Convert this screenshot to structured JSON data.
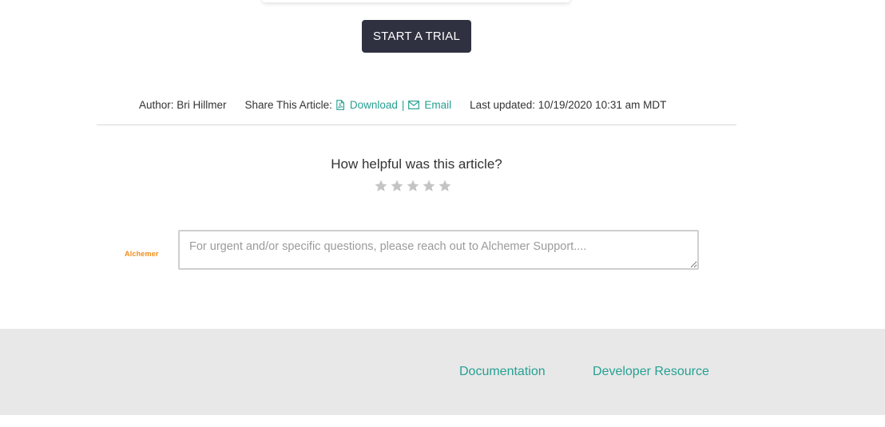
{
  "cta": {
    "label": "START A TRIAL"
  },
  "meta": {
    "author": "Author: Bri Hillmer",
    "share_label": "Share This Article:",
    "download_label": "Download",
    "separator": "|",
    "email_label": "Email",
    "last_updated": "Last updated: 10/19/2020 10:31 am MDT",
    "link_color": "#27a093"
  },
  "rating": {
    "question": "How helpful was this article?",
    "stars_total": 5,
    "stars_selected": 0,
    "star_color": "#c4c4c4"
  },
  "support": {
    "logo_text": "Alchemer",
    "placeholder": "For urgent and/or specific questions, please reach out to Alchemer Support...."
  },
  "footer": {
    "links": [
      "Documentation",
      "Developer Resource"
    ],
    "background": "#e8e8e8"
  }
}
